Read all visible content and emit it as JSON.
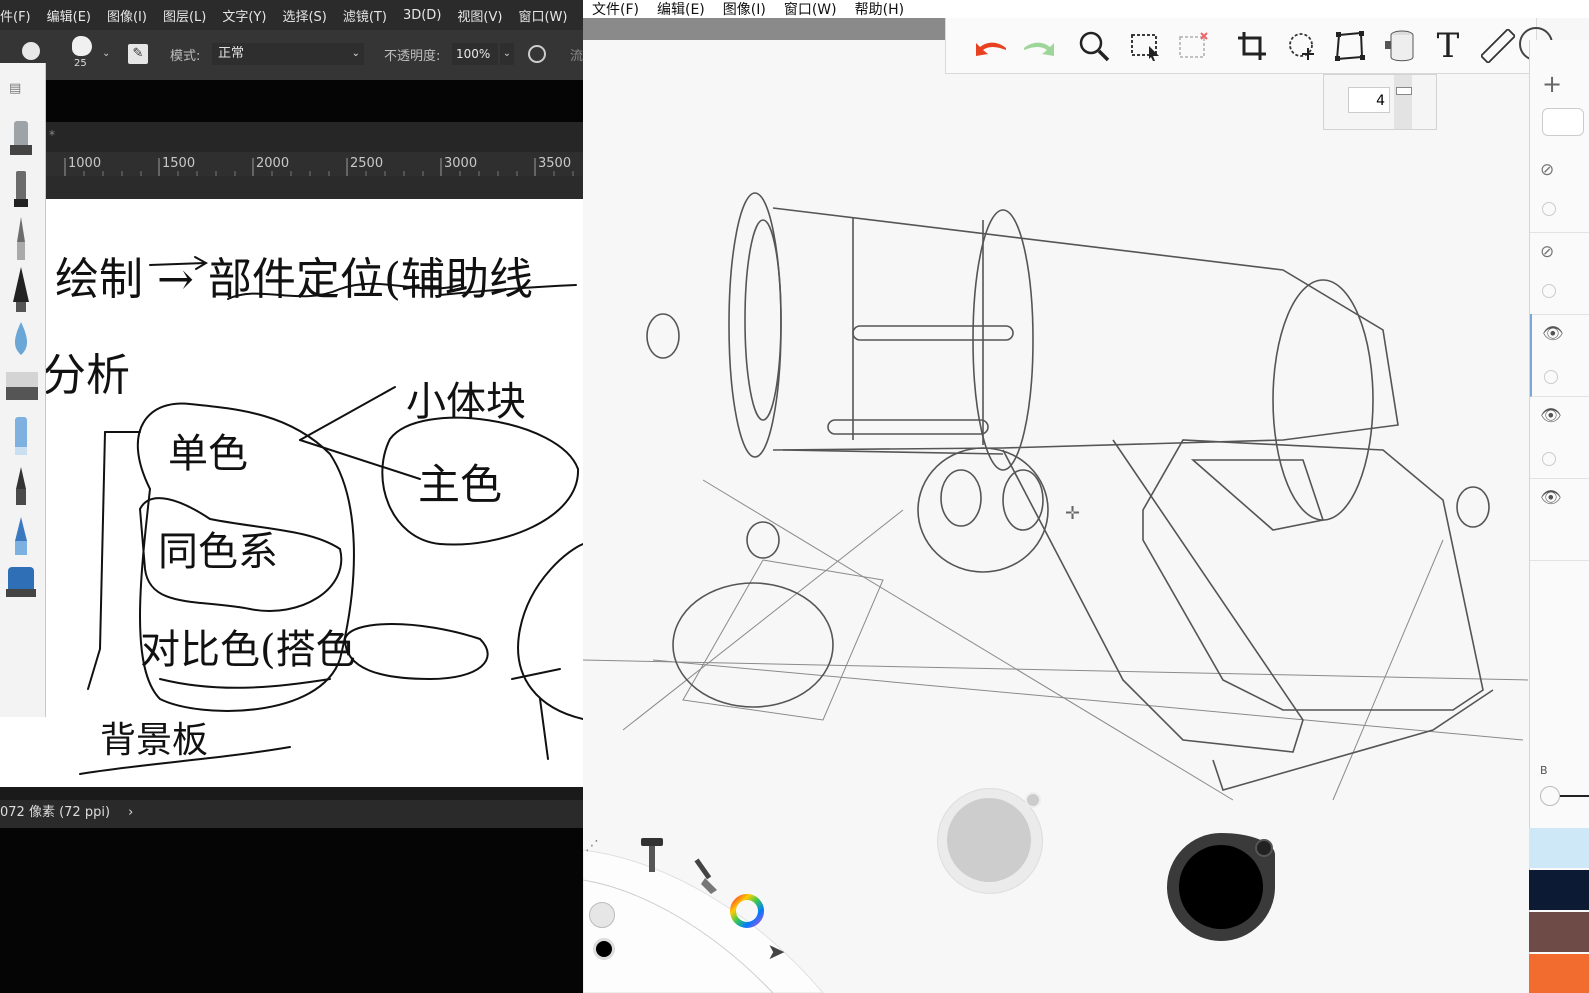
{
  "photoshop": {
    "menu": [
      "件(F)",
      "编辑(E)",
      "图像(I)",
      "图层(L)",
      "文字(Y)",
      "选择(S)",
      "滤镜(T)",
      "3D(D)",
      "视图(V)",
      "窗口(W)"
    ],
    "options": {
      "brush_size": "25",
      "mode_label": "模式:",
      "mode_value": "正常",
      "opacity_label": "不透明度:",
      "opacity_value": "100%",
      "extra": "流"
    },
    "tab_char": "*",
    "ruler_ticks": [
      "1000",
      "1500",
      "2000",
      "2500",
      "3000",
      "3500"
    ],
    "status_text": "072 像素 (72 ppi)",
    "status_arrow": "›",
    "canvas_notes": {
      "line1": "绘制 → 部件定位(辅助线",
      "line2": "分析",
      "block": "小体块",
      "main_color": "主色",
      "single_color": "单色",
      "same_color": "同色系",
      "contrast": "对比色(搭色",
      "background": "背景板"
    }
  },
  "sketchbook": {
    "menu": [
      "文件(F)",
      "编辑(E)",
      "图像(I)",
      "窗口(W)",
      "帮助(H)"
    ],
    "toolbar_icons": [
      "undo-icon",
      "redo-icon",
      "zoom-icon",
      "select-icon",
      "deselect-icon",
      "crop-icon",
      "transform-icon",
      "distort-icon",
      "fill-icon",
      "text-icon",
      "ruler-icon"
    ],
    "brush_size_value": "4",
    "layers_add": "+",
    "layer_blend_label": "B",
    "swatches": [
      "#cfe8f8",
      "#0d1a33",
      "#6e4b46",
      "#f26b2f"
    ],
    "accent_undo": "#e8411f",
    "accent_redo": "#9ed69a"
  }
}
